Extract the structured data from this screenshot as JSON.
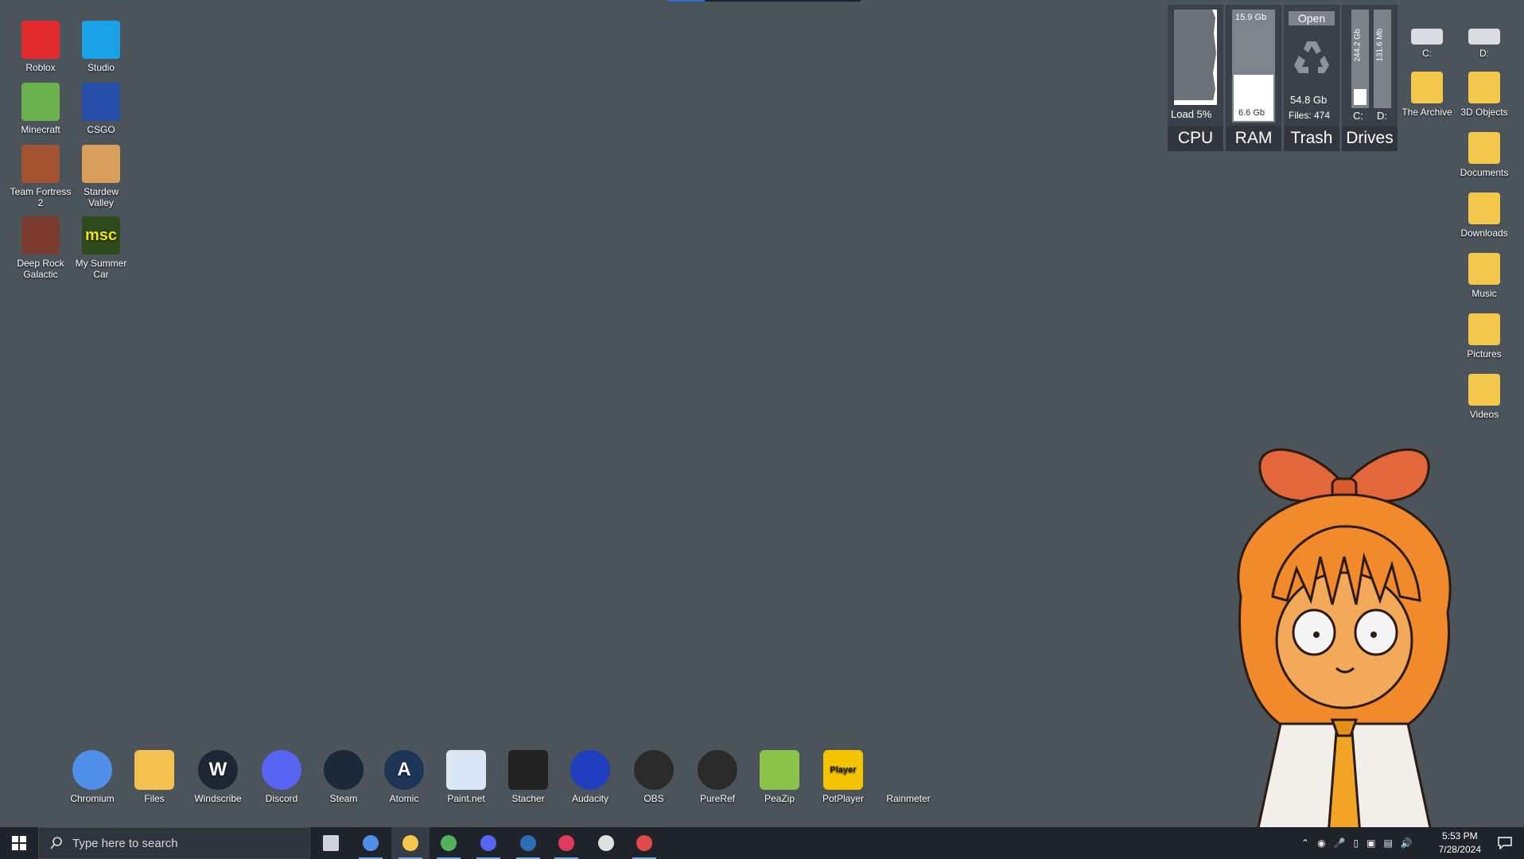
{
  "desktop_icons": [
    {
      "label": "Roblox",
      "icon": "roblox-icon"
    },
    {
      "label": "Studio",
      "icon": "studio-icon"
    },
    {
      "label": "Minecraft",
      "icon": "minecraft-icon"
    },
    {
      "label": "CSGO",
      "icon": "csgo-icon"
    },
    {
      "label": "Team Fortress 2",
      "icon": "tf2-icon"
    },
    {
      "label": "Stardew Valley",
      "icon": "stardew-icon"
    },
    {
      "label": "Deep Rock Galactic",
      "icon": "drg-icon"
    },
    {
      "label": "My Summer Car",
      "icon": "msc-icon",
      "badge": "msc"
    }
  ],
  "right_icons": [
    {
      "label": "C:",
      "icon": "drive-c-icon"
    },
    {
      "label": "D:",
      "icon": "drive-d-icon"
    },
    {
      "label": "The Archive",
      "icon": "folder-archive-icon"
    },
    {
      "label": "3D Objects",
      "icon": "folder-3d-icon"
    },
    {
      "label": "Documents",
      "icon": "folder-documents-icon"
    },
    {
      "label": "Downloads",
      "icon": "folder-downloads-icon"
    },
    {
      "label": "Music",
      "icon": "folder-music-icon"
    },
    {
      "label": "Pictures",
      "icon": "folder-pictures-icon"
    },
    {
      "label": "Videos",
      "icon": "folder-videos-icon"
    }
  ],
  "widgets": {
    "cpu": {
      "label": "CPU",
      "load_text": "Load 5%",
      "load_fraction": 0.05
    },
    "ram": {
      "label": "RAM",
      "total": "15.9 Gb",
      "used": "6.6 Gb",
      "used_fraction": 0.42
    },
    "trash": {
      "label": "Trash",
      "open_button": "Open",
      "size": "54.8 Gb",
      "files": "Files: 474"
    },
    "drives": {
      "label": "Drives",
      "c_label": "C:",
      "d_label": "D:",
      "c_free": "244.2 Gb",
      "d_free": "131.6 Mb",
      "c_used_fraction": 0.08,
      "d_used_fraction": 0.0
    }
  },
  "dock": [
    {
      "label": "Chromium",
      "icon": "chromium-icon",
      "color": "#4f8fe8"
    },
    {
      "label": "Files",
      "icon": "files-icon",
      "color": "#f2c14e"
    },
    {
      "label": "Windscribe",
      "icon": "windscribe-icon",
      "color": "#1c2733",
      "glyph": "W"
    },
    {
      "label": "Discord",
      "icon": "discord-icon",
      "color": "#5865f2"
    },
    {
      "label": "Steam",
      "icon": "steam-icon",
      "color": "#1b2838"
    },
    {
      "label": "Atomic",
      "icon": "atomic-icon",
      "color": "#1d3557",
      "glyph": "A"
    },
    {
      "label": "Paint.net",
      "icon": "paintnet-icon",
      "color": "#dbe6f5"
    },
    {
      "label": "Stacher",
      "icon": "stacher-icon",
      "color": "#222"
    },
    {
      "label": "Audacity",
      "icon": "audacity-icon",
      "color": "#1f3fbf"
    },
    {
      "label": "OBS",
      "icon": "obs-icon",
      "color": "#2b2b2b"
    },
    {
      "label": "PureRef",
      "icon": "pureref-icon",
      "color": "#2a2a2a"
    },
    {
      "label": "PeaZip",
      "icon": "peazip-icon",
      "color": "#8bc34a"
    },
    {
      "label": "PotPlayer",
      "icon": "potplayer-icon",
      "color": "#f5c400",
      "glyph": "Player"
    },
    {
      "label": "Rainmeter",
      "icon": "rainmeter-icon",
      "color": "#4b535b"
    }
  ],
  "taskbar": {
    "search_placeholder": "Type here to search",
    "apps": [
      {
        "name": "task-view-icon",
        "active": false
      },
      {
        "name": "chromium-taskbar-icon",
        "active": true
      },
      {
        "name": "file-explorer-taskbar-icon",
        "active": true
      },
      {
        "name": "vpn-taskbar-icon",
        "active": true
      },
      {
        "name": "discord-taskbar-icon",
        "active": true
      },
      {
        "name": "steam-taskbar-icon",
        "active": true
      },
      {
        "name": "stacher-taskbar-icon",
        "active": true
      },
      {
        "name": "settings-taskbar-icon",
        "active": false
      },
      {
        "name": "app-taskbar-icon",
        "active": true
      }
    ],
    "time": "5:53 PM",
    "date": "7/28/2024"
  }
}
